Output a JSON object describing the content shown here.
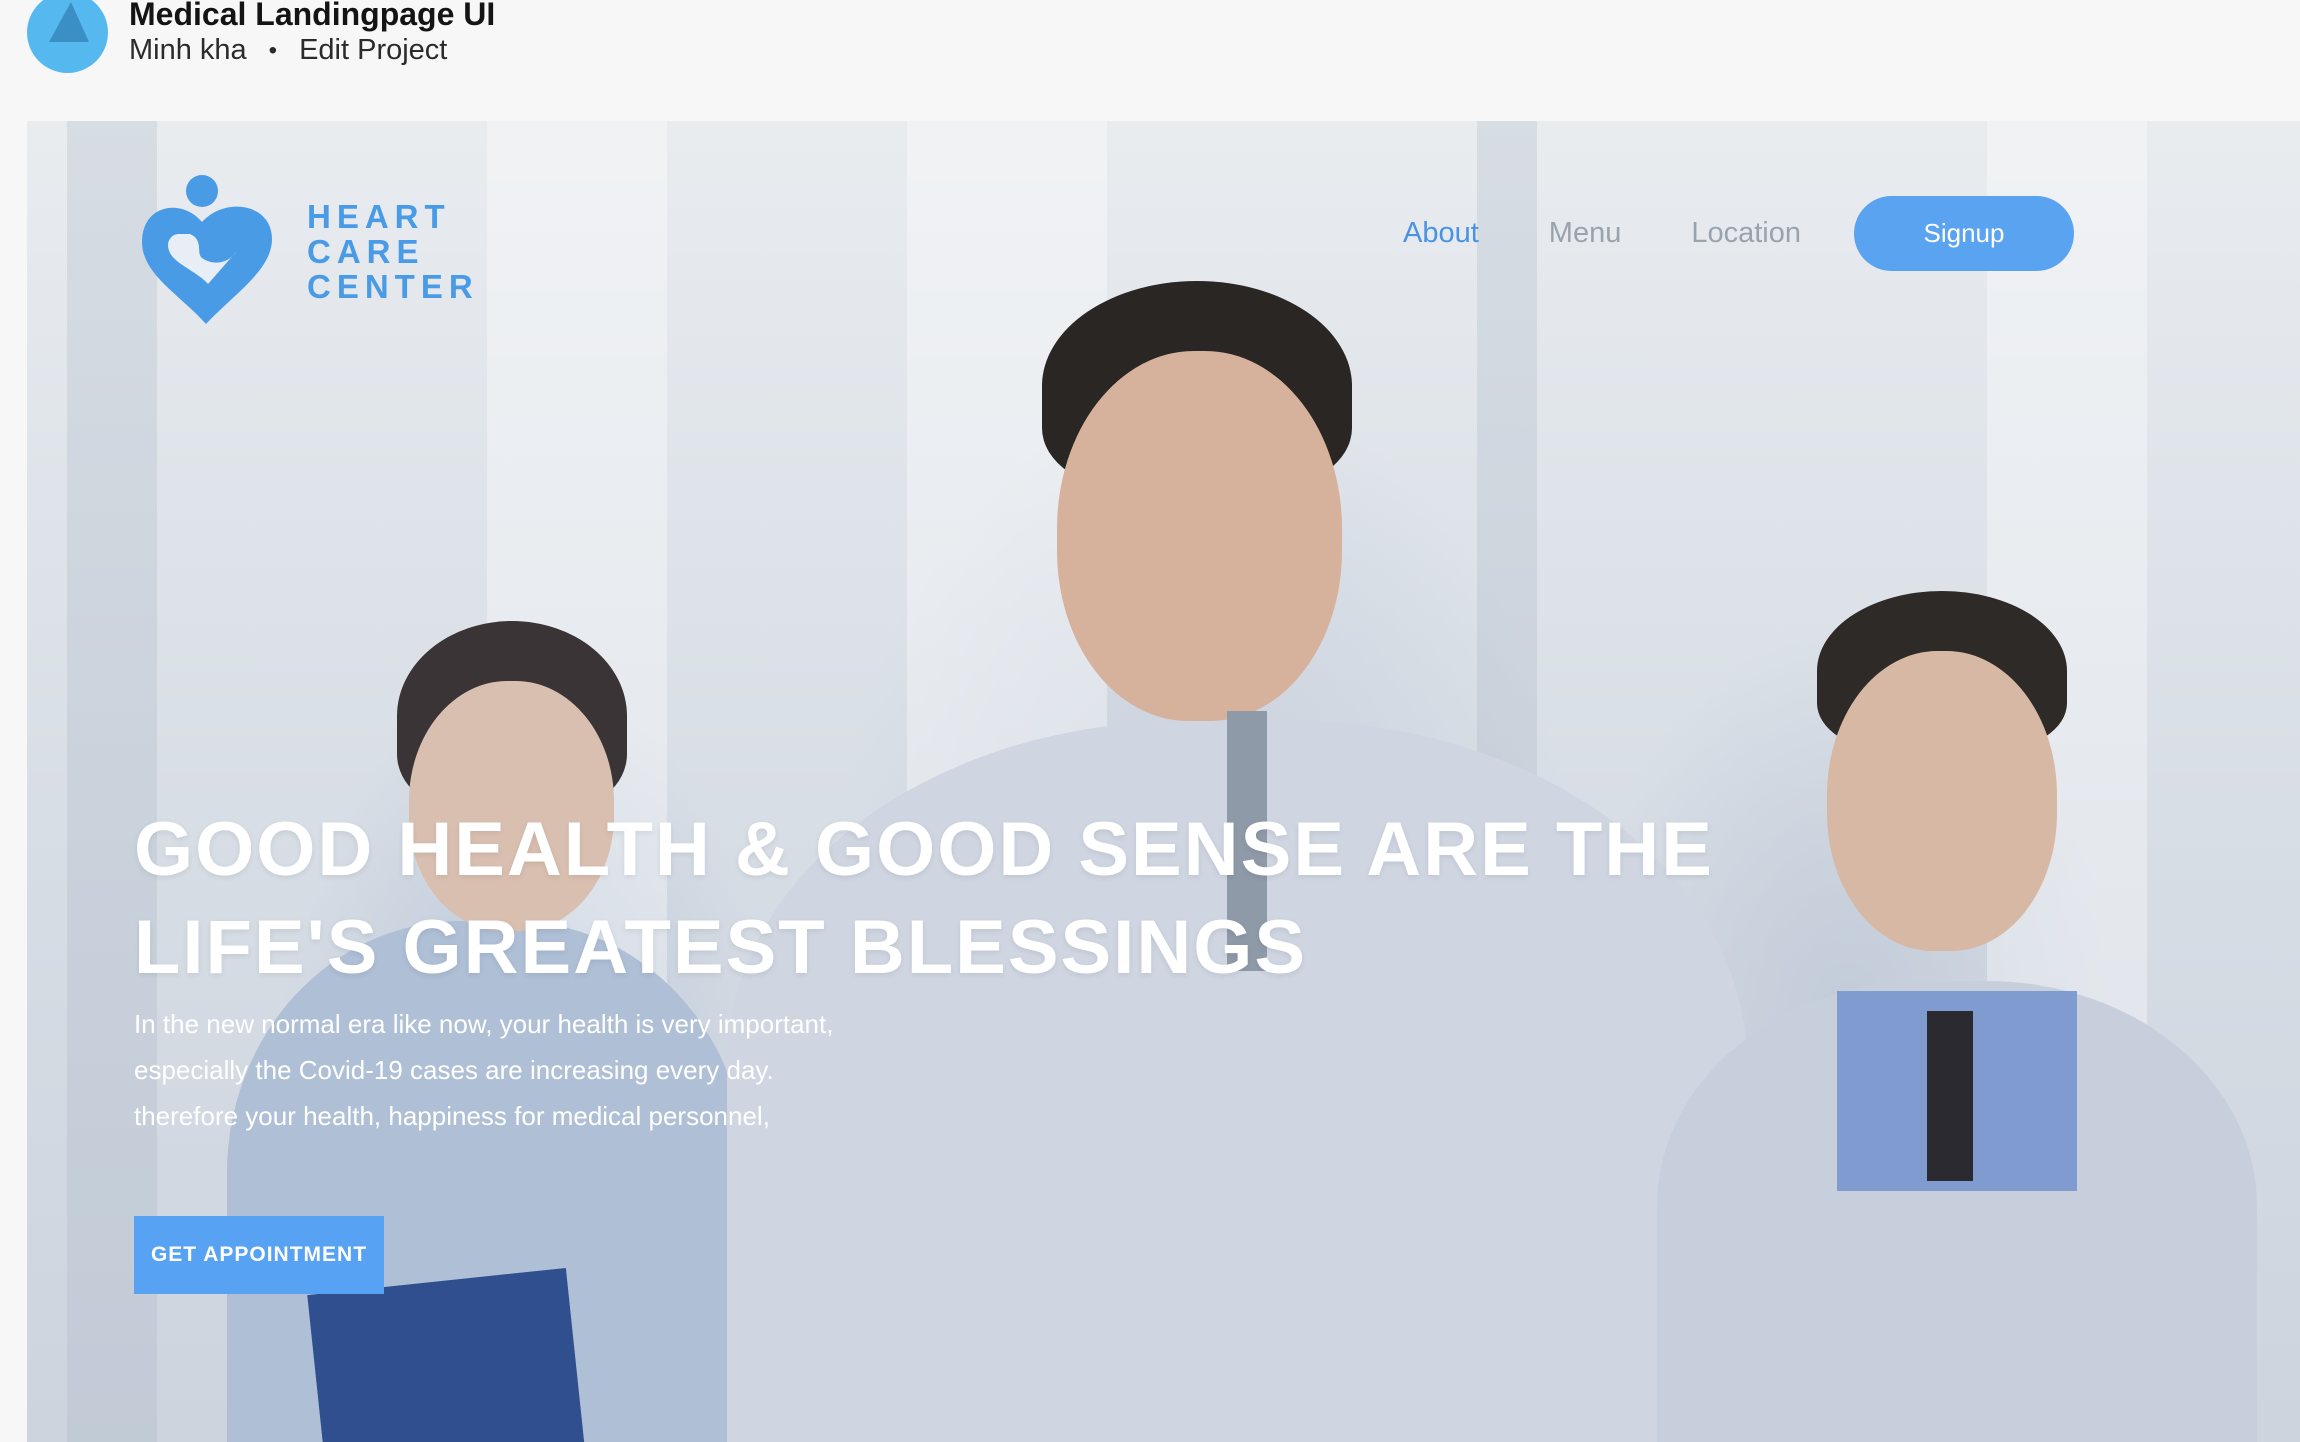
{
  "project": {
    "title": "Medical Landingpage UI",
    "author": "Minh kha",
    "separator": "•",
    "edit_label": "Edit Project",
    "avatar_color": "#55b9f0"
  },
  "site": {
    "logo": {
      "lines": [
        "HEART",
        "CARE",
        "CENTER"
      ],
      "icon": "heart-person-icon",
      "color": "#4a9be6"
    },
    "nav": {
      "items": [
        {
          "label": "About",
          "active": true
        },
        {
          "label": "Menu",
          "active": false
        },
        {
          "label": "Location",
          "active": false
        }
      ],
      "signup_label": "Signup"
    },
    "hero": {
      "title_lines": [
        "GOOD HEALTH & GOOD SENSE ARE THE",
        "LIFE'S GREATEST BLESSINGS"
      ],
      "subtitle_lines": [
        "In the new normal era like now, your health is very important,",
        "especially the Covid-19 cases are increasing every day.",
        "therefore your health, happiness for medical personnel,"
      ],
      "cta_label": "GET APPOINTMENT"
    },
    "colors": {
      "accent": "#5aa3f0",
      "nav_active": "#4a93e3",
      "nav_inactive": "#9aa3ad"
    }
  }
}
